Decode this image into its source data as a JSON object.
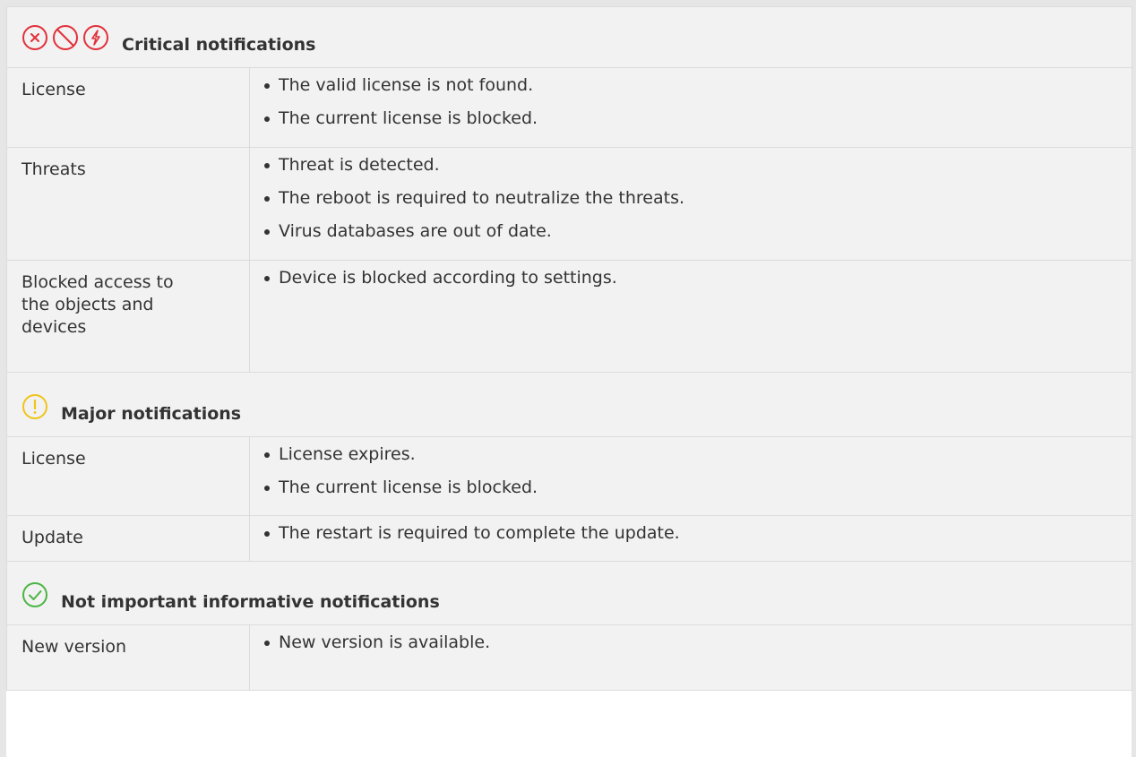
{
  "colors": {
    "critical": "#e2303b",
    "major": "#f0c419",
    "informative": "#4bb543",
    "row_bg": "#f2f2f2",
    "border": "#dcdcdc"
  },
  "sections": [
    {
      "title": "Critical notifications",
      "icons": [
        "error-circle-x-icon",
        "blocked-circle-icon",
        "lightning-circle-icon"
      ],
      "rows": [
        {
          "label": "License",
          "items": [
            "The valid license is not found.",
            "The current license is blocked."
          ]
        },
        {
          "label": "Threats",
          "items": [
            "Threat is detected.",
            "The reboot is required to neutralize the threats.",
            "Virus databases are out of date."
          ]
        },
        {
          "label": "Blocked access to the objects and devices",
          "items": [
            "Device is blocked according to settings."
          ]
        }
      ]
    },
    {
      "title": "Major notifications",
      "icons": [
        "warning-circle-icon"
      ],
      "rows": [
        {
          "label": "License",
          "items": [
            "License expires.",
            "The current license is blocked."
          ]
        },
        {
          "label": "Update",
          "items": [
            "The restart is required to complete the update."
          ]
        }
      ]
    },
    {
      "title": "Not important informative notifications",
      "icons": [
        "check-circle-icon"
      ],
      "rows": [
        {
          "label": "New version",
          "items": [
            "New version is available."
          ]
        }
      ]
    }
  ]
}
